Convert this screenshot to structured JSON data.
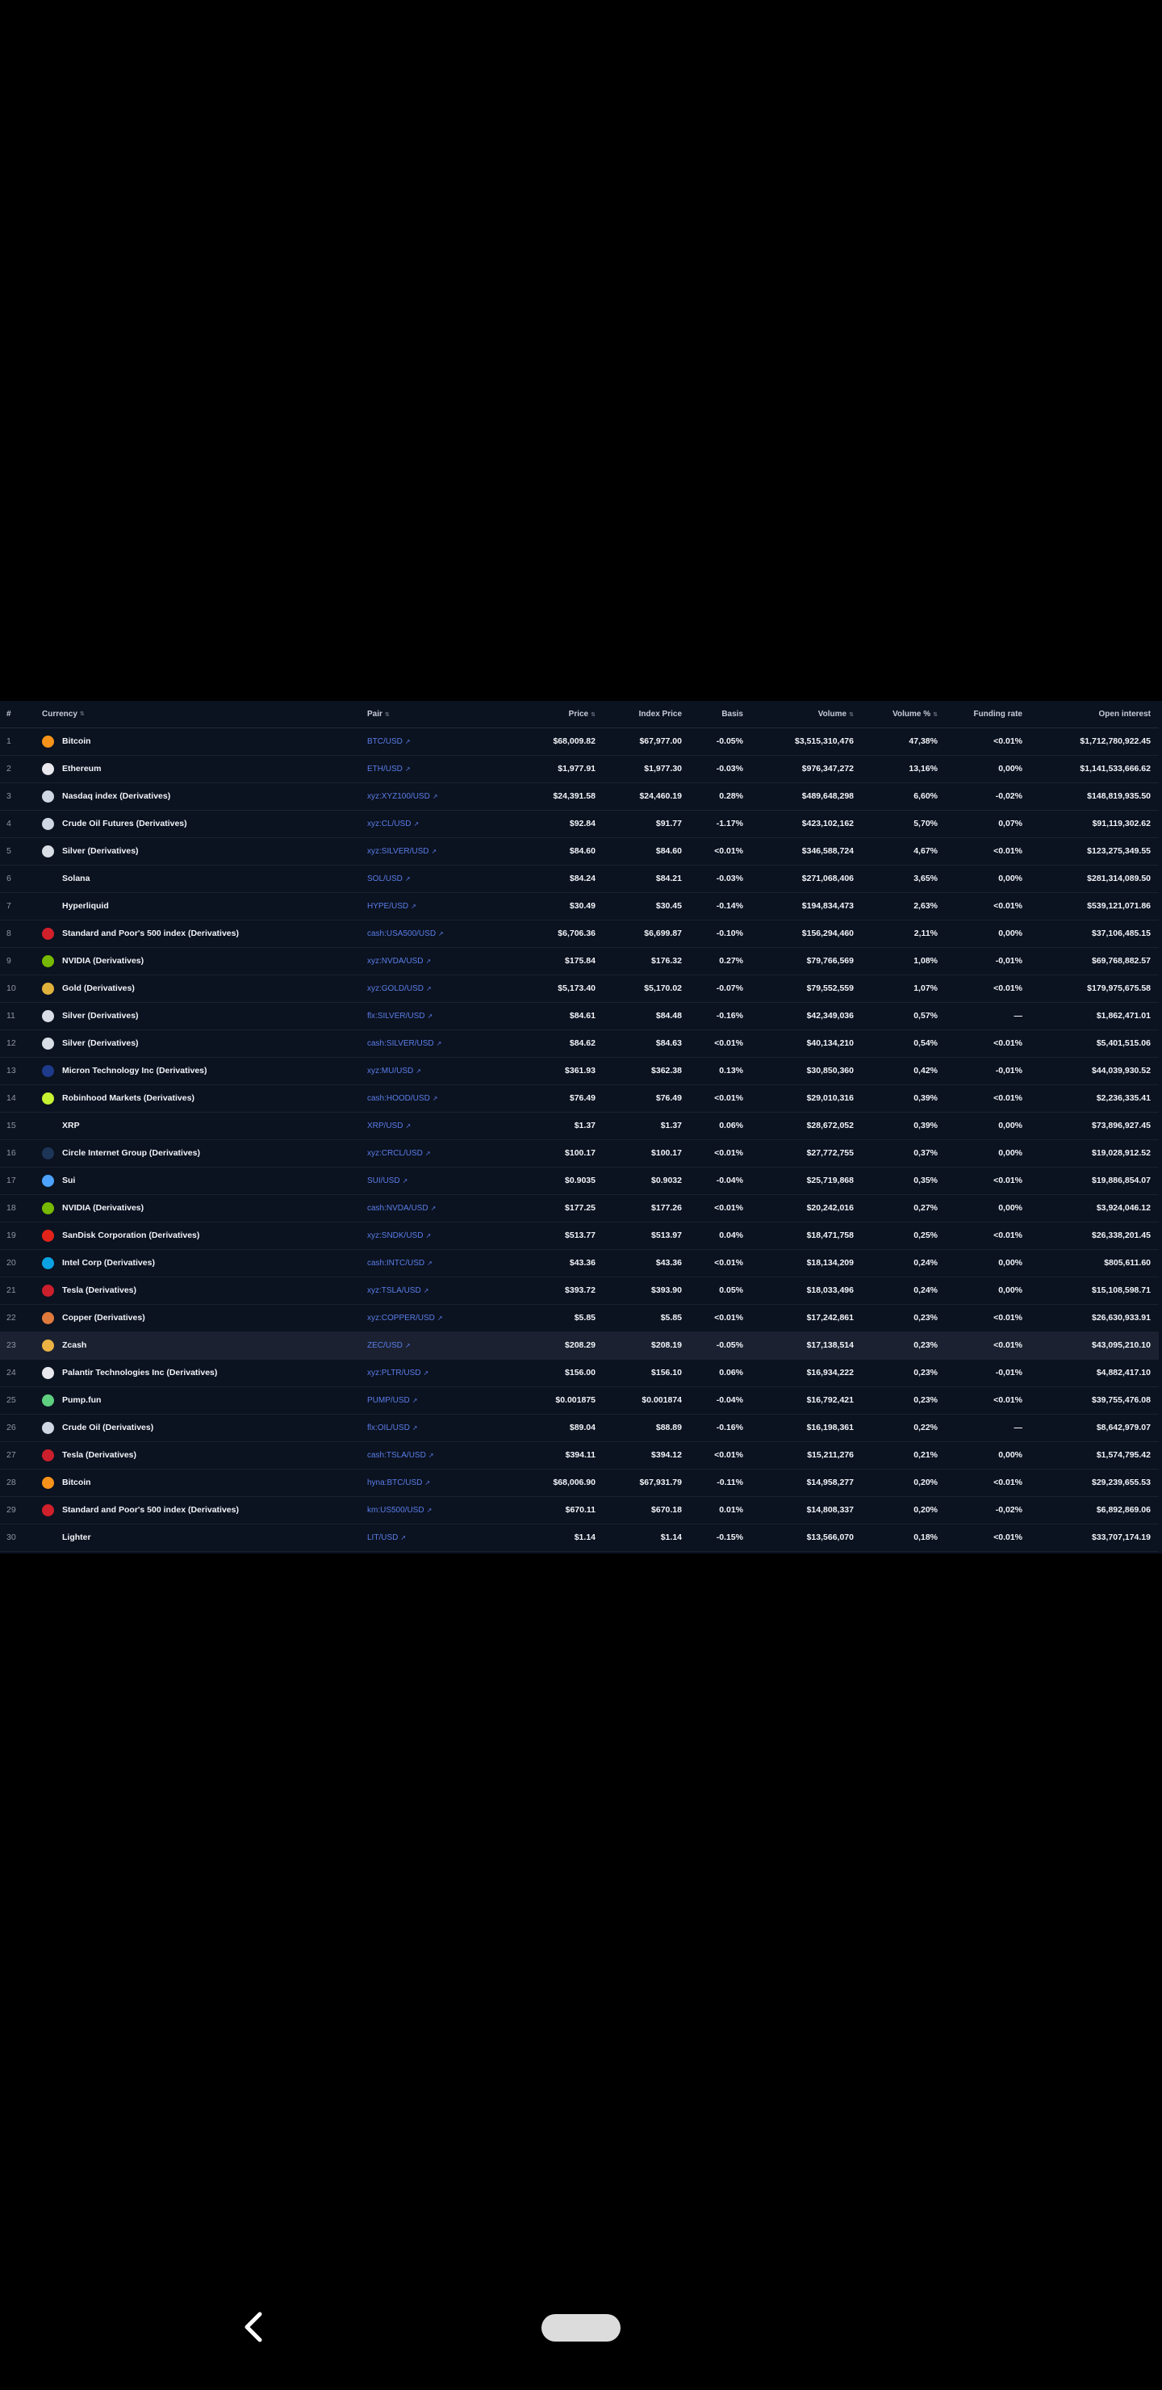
{
  "table": {
    "headers": {
      "num": "#",
      "currency": "Currency",
      "pair": "Pair",
      "price": "Price",
      "index_price": "Index Price",
      "basis": "Basis",
      "volume": "Volume",
      "volume_pct": "Volume %",
      "funding_rate": "Funding rate",
      "open_interest": "Open interest"
    },
    "rows": [
      {
        "num": "1",
        "currency": "Bitcoin",
        "pair": "BTC/USD",
        "price": "$68,009.82",
        "index_price": "$67,977.00",
        "basis": "-0.05%",
        "volume": "$3,515,310,476",
        "volume_pct": "47,38%",
        "funding_rate": "<0.01%",
        "open_interest": "$1,712,780,922.45",
        "icon_color": "#f7931a",
        "icon": "bitcoin-icon"
      },
      {
        "num": "2",
        "currency": "Ethereum",
        "pair": "ETH/USD",
        "price": "$1,977.91",
        "index_price": "$1,977.30",
        "basis": "-0.03%",
        "volume": "$976,347,272",
        "volume_pct": "13,16%",
        "funding_rate": "0,00%",
        "open_interest": "$1,141,533,666.62",
        "icon_color": "#e8e8ee",
        "icon": "ethereum-icon"
      },
      {
        "num": "3",
        "currency": "Nasdaq index (Derivatives)",
        "pair": "xyz:XYZ100/USD",
        "price": "$24,391.58",
        "index_price": "$24,460.19",
        "basis": "0.28%",
        "volume": "$489,648,298",
        "volume_pct": "6,60%",
        "funding_rate": "-0,02%",
        "open_interest": "$148,819,935.50",
        "icon_color": "#cfd6e4",
        "icon": "nasdaq-icon"
      },
      {
        "num": "4",
        "currency": "Crude Oil Futures (Derivatives)",
        "pair": "xyz:CL/USD",
        "price": "$92.84",
        "index_price": "$91.77",
        "basis": "-1.17%",
        "volume": "$423,102,162",
        "volume_pct": "5,70%",
        "funding_rate": "0,07%",
        "open_interest": "$91,119,302.62",
        "icon_color": "#cfd6e4",
        "icon": "oil-icon"
      },
      {
        "num": "5",
        "currency": "Silver (Derivatives)",
        "pair": "xyz:SILVER/USD",
        "price": "$84.60",
        "index_price": "$84.60",
        "basis": "<0.01%",
        "volume": "$346,588,724",
        "volume_pct": "4,67%",
        "funding_rate": "<0.01%",
        "open_interest": "$123,275,349.55",
        "icon_color": "#d9dde6",
        "icon": "silver-icon"
      },
      {
        "num": "6",
        "currency": "Solana",
        "pair": "SOL/USD",
        "price": "$84.24",
        "index_price": "$84.21",
        "basis": "-0.03%",
        "volume": "$271,068,406",
        "volume_pct": "3,65%",
        "funding_rate": "0,00%",
        "open_interest": "$281,314,089.50",
        "icon_color": "#0b1220",
        "icon": "solana-icon"
      },
      {
        "num": "7",
        "currency": "Hyperliquid",
        "pair": "HYPE/USD",
        "price": "$30.49",
        "index_price": "$30.45",
        "basis": "-0.14%",
        "volume": "$194,834,473",
        "volume_pct": "2,63%",
        "funding_rate": "<0.01%",
        "open_interest": "$539,121,071.86",
        "icon_color": "#0b1220",
        "icon": "hyperliquid-icon"
      },
      {
        "num": "8",
        "currency": "Standard and Poor's 500 index (Derivatives)",
        "pair": "cash:USA500/USD",
        "price": "$6,706.36",
        "index_price": "$6,699.87",
        "basis": "-0.10%",
        "volume": "$156,294,460",
        "volume_pct": "2,11%",
        "funding_rate": "0,00%",
        "open_interest": "$37,106,485.15",
        "icon_color": "#d0202b",
        "icon": "sp500-icon"
      },
      {
        "num": "9",
        "currency": "NVIDIA (Derivatives)",
        "pair": "xyz:NVDA/USD",
        "price": "$175.84",
        "index_price": "$176.32",
        "basis": "0.27%",
        "volume": "$79,766,569",
        "volume_pct": "1,08%",
        "funding_rate": "-0,01%",
        "open_interest": "$69,768,882.57",
        "icon_color": "#76b900",
        "icon": "nvidia-icon"
      },
      {
        "num": "10",
        "currency": "Gold (Derivatives)",
        "pair": "xyz:GOLD/USD",
        "price": "$5,173.40",
        "index_price": "$5,170.02",
        "basis": "-0.07%",
        "volume": "$79,552,559",
        "volume_pct": "1,07%",
        "funding_rate": "<0.01%",
        "open_interest": "$179,975,675.58",
        "icon_color": "#e0b23c",
        "icon": "gold-icon"
      },
      {
        "num": "11",
        "currency": "Silver (Derivatives)",
        "pair": "flx:SILVER/USD",
        "price": "$84.61",
        "index_price": "$84.48",
        "basis": "-0.16%",
        "volume": "$42,349,036",
        "volume_pct": "0,57%",
        "funding_rate": "—",
        "open_interest": "$1,862,471.01",
        "icon_color": "#d9dde6",
        "icon": "silver-icon"
      },
      {
        "num": "12",
        "currency": "Silver (Derivatives)",
        "pair": "cash:SILVER/USD",
        "price": "$84.62",
        "index_price": "$84.63",
        "basis": "<0.01%",
        "volume": "$40,134,210",
        "volume_pct": "0,54%",
        "funding_rate": "<0.01%",
        "open_interest": "$5,401,515.06",
        "icon_color": "#d9dde6",
        "icon": "silver-icon"
      },
      {
        "num": "13",
        "currency": "Micron Technology Inc (Derivatives)",
        "pair": "xyz:MU/USD",
        "price": "$361.93",
        "index_price": "$362.38",
        "basis": "0.13%",
        "volume": "$30,850,360",
        "volume_pct": "0,42%",
        "funding_rate": "-0,01%",
        "open_interest": "$44,039,930.52",
        "icon_color": "#1e3a8a",
        "icon": "micron-icon"
      },
      {
        "num": "14",
        "currency": "Robinhood Markets (Derivatives)",
        "pair": "cash:HOOD/USD",
        "price": "$76.49",
        "index_price": "$76.49",
        "basis": "<0.01%",
        "volume": "$29,010,316",
        "volume_pct": "0,39%",
        "funding_rate": "<0.01%",
        "open_interest": "$2,236,335.41",
        "icon_color": "#c6f432",
        "icon": "robinhood-icon"
      },
      {
        "num": "15",
        "currency": "XRP",
        "pair": "XRP/USD",
        "price": "$1.37",
        "index_price": "$1.37",
        "basis": "0.06%",
        "volume": "$28,672,052",
        "volume_pct": "0,39%",
        "funding_rate": "0,00%",
        "open_interest": "$73,896,927.45",
        "icon_color": "#0b1220",
        "icon": "xrp-icon"
      },
      {
        "num": "16",
        "currency": "Circle Internet Group (Derivatives)",
        "pair": "xyz:CRCL/USD",
        "price": "$100.17",
        "index_price": "$100.17",
        "basis": "<0.01%",
        "volume": "$27,772,755",
        "volume_pct": "0,37%",
        "funding_rate": "0,00%",
        "open_interest": "$19,028,912.52",
        "icon_color": "#1d3557",
        "icon": "circle-icon"
      },
      {
        "num": "17",
        "currency": "Sui",
        "pair": "SUI/USD",
        "price": "$0.9035",
        "index_price": "$0.9032",
        "basis": "-0.04%",
        "volume": "$25,719,868",
        "volume_pct": "0,35%",
        "funding_rate": "<0.01%",
        "open_interest": "$19,886,854.07",
        "icon_color": "#4da2ff",
        "icon": "sui-icon"
      },
      {
        "num": "18",
        "currency": "NVIDIA (Derivatives)",
        "pair": "cash:NVDA/USD",
        "price": "$177.25",
        "index_price": "$177.26",
        "basis": "<0.01%",
        "volume": "$20,242,016",
        "volume_pct": "0,27%",
        "funding_rate": "0,00%",
        "open_interest": "$3,924,046.12",
        "icon_color": "#76b900",
        "icon": "nvidia-icon"
      },
      {
        "num": "19",
        "currency": "SanDisk Corporation (Derivatives)",
        "pair": "xyz:SNDK/USD",
        "price": "$513.77",
        "index_price": "$513.97",
        "basis": "0.04%",
        "volume": "$18,471,758",
        "volume_pct": "0,25%",
        "funding_rate": "<0.01%",
        "open_interest": "$26,338,201.45",
        "icon_color": "#e2231a",
        "icon": "sandisk-icon"
      },
      {
        "num": "20",
        "currency": "Intel Corp (Derivatives)",
        "pair": "cash:INTC/USD",
        "price": "$43.36",
        "index_price": "$43.36",
        "basis": "<0.01%",
        "volume": "$18,134,209",
        "volume_pct": "0,24%",
        "funding_rate": "0,00%",
        "open_interest": "$805,611.60",
        "icon_color": "#0aa2e2",
        "icon": "intel-icon"
      },
      {
        "num": "21",
        "currency": "Tesla (Derivatives)",
        "pair": "xyz:TSLA/USD",
        "price": "$393.72",
        "index_price": "$393.90",
        "basis": "0.05%",
        "volume": "$18,033,496",
        "volume_pct": "0,24%",
        "funding_rate": "0,00%",
        "open_interest": "$15,108,598.71",
        "icon_color": "#cc1f2c",
        "icon": "tesla-icon"
      },
      {
        "num": "22",
        "currency": "Copper (Derivatives)",
        "pair": "xyz:COPPER/USD",
        "price": "$5.85",
        "index_price": "$5.85",
        "basis": "<0.01%",
        "volume": "$17,242,861",
        "volume_pct": "0,23%",
        "funding_rate": "<0.01%",
        "open_interest": "$26,630,933.91",
        "icon_color": "#e07a3c",
        "icon": "copper-icon"
      },
      {
        "num": "23",
        "currency": "Zcash",
        "pair": "ZEC/USD",
        "price": "$208.29",
        "index_price": "$208.19",
        "basis": "-0.05%",
        "volume": "$17,138,514",
        "volume_pct": "0,23%",
        "funding_rate": "<0.01%",
        "open_interest": "$43,095,210.10",
        "icon_color": "#ecb244",
        "icon": "zcash-icon"
      },
      {
        "num": "24",
        "currency": "Palantir Technologies Inc (Derivatives)",
        "pair": "xyz:PLTR/USD",
        "price": "$156.00",
        "index_price": "$156.10",
        "basis": "0.06%",
        "volume": "$16,934,222",
        "volume_pct": "0,23%",
        "funding_rate": "-0,01%",
        "open_interest": "$4,882,417.10",
        "icon_color": "#e8e8ee",
        "icon": "palantir-icon"
      },
      {
        "num": "25",
        "currency": "Pump.fun",
        "pair": "PUMP/USD",
        "price": "$0.001875",
        "index_price": "$0.001874",
        "basis": "-0.04%",
        "volume": "$16,792,421",
        "volume_pct": "0,23%",
        "funding_rate": "<0.01%",
        "open_interest": "$39,755,476.08",
        "icon_color": "#5fcf80",
        "icon": "pump-icon"
      },
      {
        "num": "26",
        "currency": "Crude Oil (Derivatives)",
        "pair": "flx:OIL/USD",
        "price": "$89.04",
        "index_price": "$88.89",
        "basis": "-0.16%",
        "volume": "$16,198,361",
        "volume_pct": "0,22%",
        "funding_rate": "—",
        "open_interest": "$8,642,979.07",
        "icon_color": "#cfd6e4",
        "icon": "oil-icon"
      },
      {
        "num": "27",
        "currency": "Tesla (Derivatives)",
        "pair": "cash:TSLA/USD",
        "price": "$394.11",
        "index_price": "$394.12",
        "basis": "<0.01%",
        "volume": "$15,211,276",
        "volume_pct": "0,21%",
        "funding_rate": "0,00%",
        "open_interest": "$1,574,795.42",
        "icon_color": "#cc1f2c",
        "icon": "tesla-icon"
      },
      {
        "num": "28",
        "currency": "Bitcoin",
        "pair": "hyna:BTC/USD",
        "price": "$68,006.90",
        "index_price": "$67,931.79",
        "basis": "-0.11%",
        "volume": "$14,958,277",
        "volume_pct": "0,20%",
        "funding_rate": "<0.01%",
        "open_interest": "$29,239,655.53",
        "icon_color": "#f7931a",
        "icon": "bitcoin-icon"
      },
      {
        "num": "29",
        "currency": "Standard and Poor's 500 index (Derivatives)",
        "pair": "km:US500/USD",
        "price": "$670.11",
        "index_price": "$670.18",
        "basis": "0.01%",
        "volume": "$14,808,337",
        "volume_pct": "0,20%",
        "funding_rate": "-0,02%",
        "open_interest": "$6,892,869.06",
        "icon_color": "#d0202b",
        "icon": "sp500-icon"
      },
      {
        "num": "30",
        "currency": "Lighter",
        "pair": "LIT/USD",
        "price": "$1.14",
        "index_price": "$1.14",
        "basis": "-0.15%",
        "volume": "$13,566,070",
        "volume_pct": "0,18%",
        "funding_rate": "<0.01%",
        "open_interest": "$33,707,174.19",
        "icon_color": "#0b1220",
        "icon": "lighter-icon"
      }
    ],
    "highlighted_row": "23"
  },
  "nav": {
    "back_icon": "chevron-left-icon",
    "home_icon": "home-pill-icon"
  }
}
